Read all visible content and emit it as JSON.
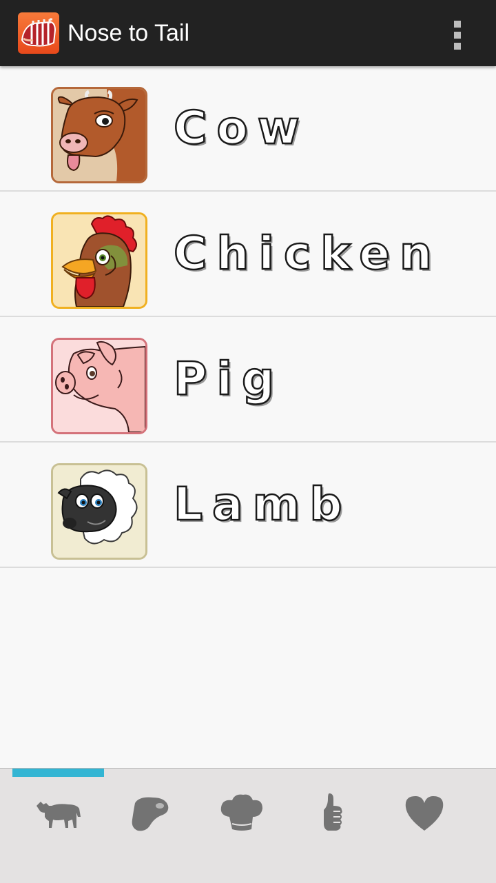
{
  "app": {
    "title": "Nose to Tail",
    "icon": "meat-rack-icon",
    "menu_icon": "overflow-menu-icon"
  },
  "animals": [
    {
      "name": "Cow",
      "icon": "cow-face-icon",
      "border": "#b5683a",
      "bg": "#e3c9a8"
    },
    {
      "name": "Chicken",
      "icon": "rooster-face-icon",
      "border": "#f0b020",
      "bg": "#f8dca0"
    },
    {
      "name": "Pig",
      "icon": "pig-face-icon",
      "border": "#d4727a",
      "bg": "#f9d6d6"
    },
    {
      "name": "Lamb",
      "icon": "sheep-face-icon",
      "border": "#c8c094",
      "bg": "#f0ead0"
    }
  ],
  "tabs": [
    {
      "name": "animals",
      "icon": "cow-silhouette-icon",
      "selected": true
    },
    {
      "name": "cuts",
      "icon": "steak-icon",
      "selected": false
    },
    {
      "name": "recipes",
      "icon": "chef-hat-icon",
      "selected": false
    },
    {
      "name": "recommended",
      "icon": "thumbs-up-icon",
      "selected": false
    },
    {
      "name": "favorites",
      "icon": "heart-icon",
      "selected": false
    }
  ],
  "colors": {
    "actionbar": "#222222",
    "accent": "#33b5d3",
    "tab_icon": "#737373"
  }
}
